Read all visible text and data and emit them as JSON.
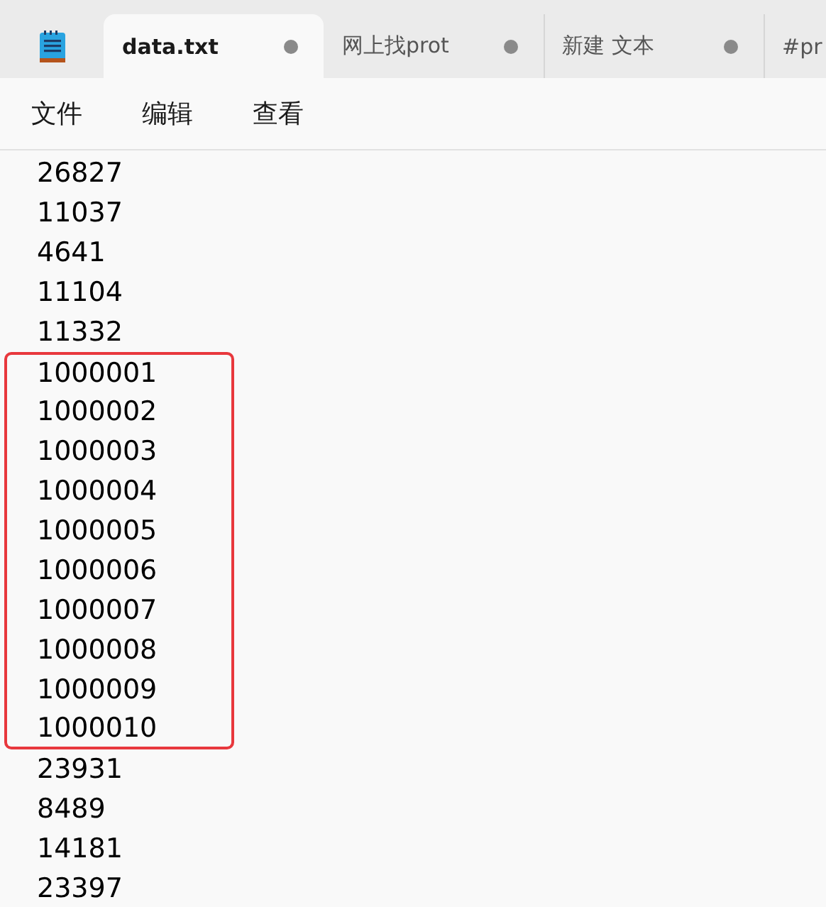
{
  "tabs": [
    {
      "label": "data.txt",
      "selected": true,
      "unsaved": true
    },
    {
      "label": "网上找prot",
      "selected": false,
      "unsaved": true
    },
    {
      "label": "新建 文本",
      "selected": false,
      "unsaved": true
    },
    {
      "label": "#pr",
      "selected": false
    }
  ],
  "menu": [
    "文件",
    "编辑",
    "查看"
  ],
  "lines": [
    {
      "text": "26827",
      "highlighted": false
    },
    {
      "text": "11037",
      "highlighted": false
    },
    {
      "text": "4641",
      "highlighted": false
    },
    {
      "text": "11104",
      "highlighted": false
    },
    {
      "text": "11332",
      "highlighted": false
    },
    {
      "text": "1000001",
      "highlighted": true
    },
    {
      "text": "1000002",
      "highlighted": true
    },
    {
      "text": "1000003",
      "highlighted": true
    },
    {
      "text": "1000004",
      "highlighted": true
    },
    {
      "text": "1000005",
      "highlighted": true
    },
    {
      "text": "1000006",
      "highlighted": true
    },
    {
      "text": "1000007",
      "highlighted": true
    },
    {
      "text": "1000008",
      "highlighted": true
    },
    {
      "text": "1000009",
      "highlighted": true
    },
    {
      "text": "1000010",
      "highlighted": true
    },
    {
      "text": "23931",
      "highlighted": false
    },
    {
      "text": "8489",
      "highlighted": false
    },
    {
      "text": "14181",
      "highlighted": false
    },
    {
      "text": "23397",
      "highlighted": false
    }
  ]
}
